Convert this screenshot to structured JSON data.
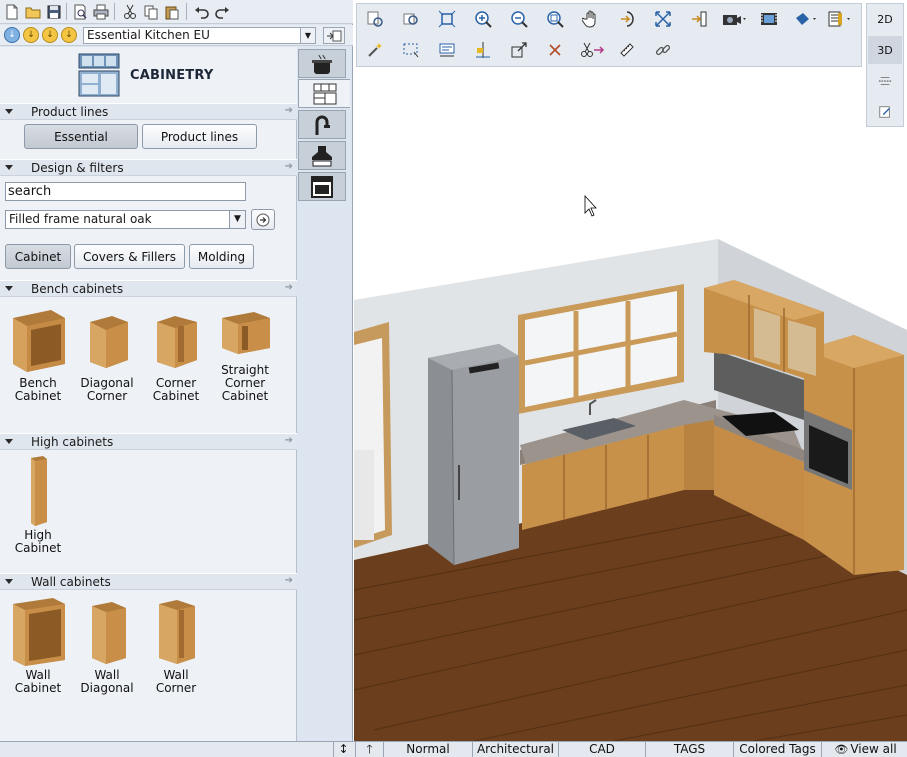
{
  "catalog": {
    "name": "Essential Kitchen EU",
    "header_title": "CABINETRY"
  },
  "sections": {
    "product_lines": "Product lines",
    "design_filters": "Design & filters",
    "bench": "Bench cabinets",
    "high": "High cabinets",
    "wall": "Wall cabinets"
  },
  "product_line_buttons": {
    "essential": "Essential",
    "product_lines": "Product lines"
  },
  "filters": {
    "search_value": "search",
    "style": "Filled frame natural oak",
    "types": [
      "Cabinet",
      "Covers & Fillers",
      "Molding"
    ]
  },
  "bench_items": [
    {
      "l1": "Bench",
      "l2": "Cabinet",
      "l3": ""
    },
    {
      "l1": "Diagonal",
      "l2": "Corner",
      "l3": ""
    },
    {
      "l1": "Corner",
      "l2": "Cabinet",
      "l3": ""
    },
    {
      "l1": "Straight",
      "l2": "Corner",
      "l3": "Cabinet"
    }
  ],
  "high_items": [
    {
      "l1": "High",
      "l2": "Cabinet"
    }
  ],
  "wall_items": [
    {
      "l1": "Wall",
      "l2": "Cabinet"
    },
    {
      "l1": "Wall",
      "l2": "Diagonal"
    },
    {
      "l1": "Wall",
      "l2": "Corner"
    }
  ],
  "view_modes": [
    "2D",
    "3D"
  ],
  "status_bar": [
    "Normal",
    "Architectural",
    "CAD",
    "TAGS",
    "Colored Tags",
    "View all"
  ],
  "colors": {
    "panel": "#eef2f7",
    "wood": "#c8914a",
    "floor": "#6b3f1d",
    "wall": "#dcdfe2"
  }
}
